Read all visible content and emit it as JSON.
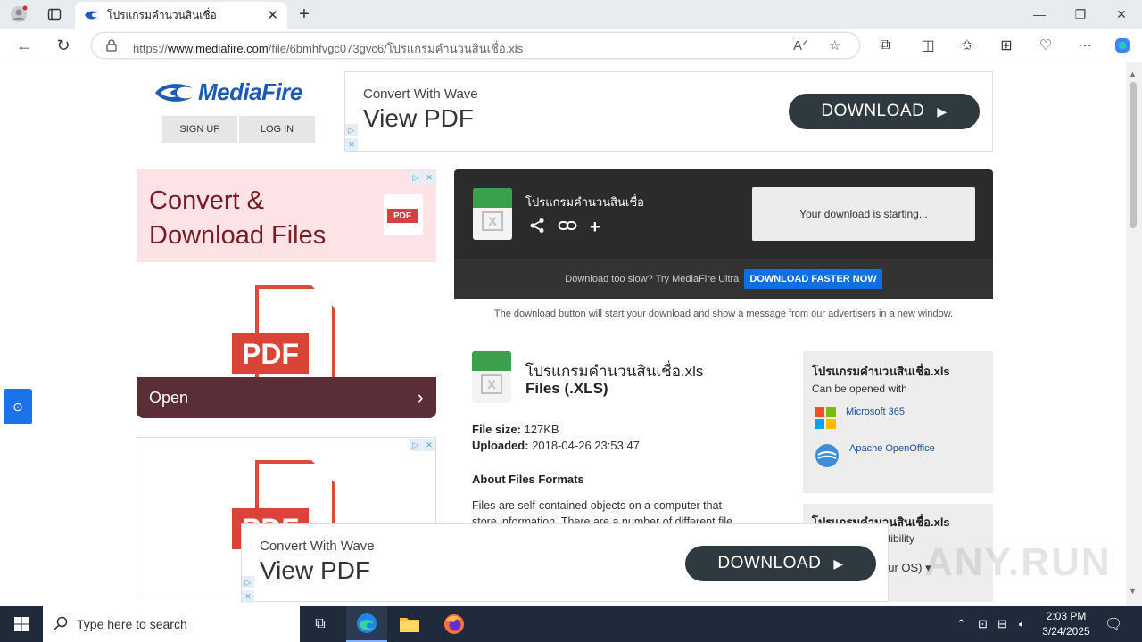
{
  "browser": {
    "tab_title": "โปรแกรมคำนวนสินเชื่อ",
    "url_prefix": "https://",
    "url_host": "www.mediafire.com",
    "url_path": "/file/6bmhfvgc073gvc6/โปรแกรมคำนวนสินเชื่อ.xls",
    "new_tab_icon": "plus",
    "colors": {
      "titlebar": "#e8ebf0",
      "accent": "#1a73e8"
    }
  },
  "header": {
    "logo_text": "MediaFire",
    "signup_label": "SIGN UP",
    "login_label": "LOG IN"
  },
  "ad_top": {
    "subtitle": "Convert With Wave",
    "title": "View PDF",
    "download_label": "DOWNLOAD"
  },
  "ad_left": {
    "headline_1": "Convert &",
    "headline_2": "Download Files",
    "pdf_label": "PDF",
    "open_label": "Open"
  },
  "download_box": {
    "filename": "โปรแกรมคำนวนสินเชื่อ",
    "status": "Your download is starting...",
    "slow_text": "Download too slow? Try MediaFire Ultra",
    "faster_label": "DOWNLOAD FASTER NOW",
    "note": "The download button will start your download and show a message from our advertisers in a new window."
  },
  "file_info": {
    "name": "โปรแกรมคำนวนสินเชื่อ.xls",
    "type": "Files (.XLS)",
    "size_label": "File size:",
    "size_value": "127KB",
    "uploaded_label": "Uploaded:",
    "uploaded_value": "2018-04-26 23:53:47",
    "about_title": "About Files Formats",
    "about_text": "Files are self-contained objects on a computer that store information. There are a number of different file"
  },
  "sidebar": {
    "open_title": "โปรแกรมคำนวนสินเชื่อ.xls",
    "open_subtitle": "Can be opened with",
    "apps": [
      {
        "name": "Microsoft 365"
      },
      {
        "name": "Apache OpenOffice"
      }
    ],
    "compat_title": "โปรแกรมคำนวนสินเชื่อ.xls",
    "compat_subtitle": "tibility",
    "os_select": "our OS)"
  },
  "ad_bottom": {
    "subtitle": "Convert With Wave",
    "title": "View PDF",
    "download_label": "DOWNLOAD"
  },
  "watermark": "ANY.RUN",
  "taskbar": {
    "search_placeholder": "Type here to search",
    "time": "2:03 PM",
    "date": "3/24/2025"
  }
}
